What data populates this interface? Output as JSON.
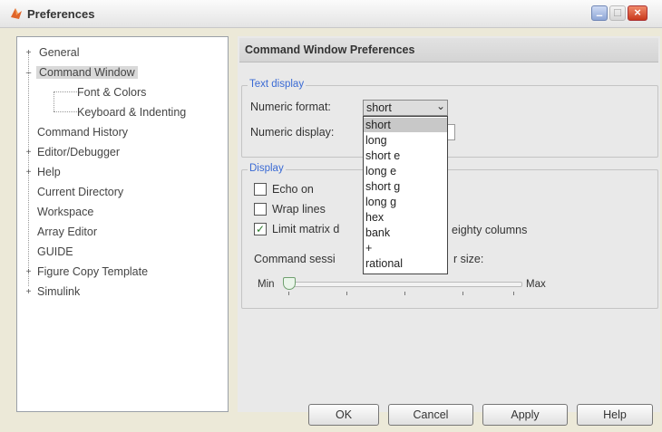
{
  "window": {
    "title": "Preferences",
    "controls": {
      "minimize": "–",
      "maximize": "□",
      "close": "×"
    }
  },
  "tree": {
    "items": [
      {
        "label": "General",
        "expander": "+"
      },
      {
        "label": "Command Window",
        "expander": "–"
      },
      {
        "label": "Font & Colors"
      },
      {
        "label": "Keyboard & Indenting"
      },
      {
        "label": "Command History"
      },
      {
        "label": "Editor/Debugger",
        "expander": "+"
      },
      {
        "label": "Help",
        "expander": "+"
      },
      {
        "label": "Current Directory"
      },
      {
        "label": "Workspace"
      },
      {
        "label": "Array Editor"
      },
      {
        "label": "GUIDE"
      },
      {
        "label": "Figure Copy Template",
        "expander": "+"
      },
      {
        "label": "Simulink",
        "expander": "+"
      }
    ],
    "selected": "Command Window"
  },
  "panel": {
    "title": "Command Window Preferences",
    "text_display": {
      "group_label": "Text display",
      "numeric_format_label": "Numeric format:",
      "numeric_format_value": "short",
      "numeric_display_label": "Numeric display:",
      "numeric_display_value": ""
    },
    "display": {
      "group_label": "Display",
      "echo_on": {
        "label": "Echo on",
        "checked": false
      },
      "wrap_lines": {
        "label": "Wrap lines",
        "checked": false
      },
      "limit_matrix": {
        "label_left": "Limit matrix d",
        "label_right": "eighty columns",
        "checked": true
      },
      "session_label_left": "Command sessi",
      "session_label_right": "r size:",
      "slider_min": "Min",
      "slider_max": "Max",
      "slider_level": 0
    }
  },
  "format_options": [
    "short",
    "long",
    "short e",
    "long e",
    "short g",
    "long g",
    "hex",
    "bank",
    "+",
    "rational"
  ],
  "buttons": {
    "ok": "OK",
    "cancel": "Cancel",
    "apply": "Apply",
    "help": "Help"
  },
  "colors": {
    "group_label": "#3a6ad4",
    "check_mark": "#2a7a2a"
  }
}
